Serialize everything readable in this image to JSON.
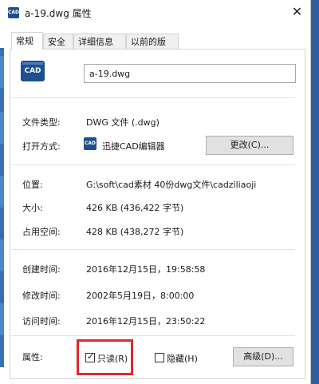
{
  "window": {
    "title": "a-19.dwg 属性",
    "app_icon": "cad-file-icon",
    "close_glyph": "✕"
  },
  "tabs": [
    {
      "label": "常规",
      "active": true
    },
    {
      "label": "安全",
      "active": false
    },
    {
      "label": "详细信息",
      "active": false
    },
    {
      "label": "以前的版本",
      "active": false
    }
  ],
  "file": {
    "icon_text": "CAD",
    "name": "a-19.dwg"
  },
  "type_row": {
    "label": "文件类型:",
    "value": "DWG 文件 (.dwg)"
  },
  "open_with": {
    "label": "打开方式:",
    "icon_text": "CAD",
    "app": "迅捷CAD编辑器",
    "change_button": "更改(C)..."
  },
  "location": {
    "label": "位置:",
    "value": "G:\\soft\\cad素材 40份dwg文件\\cadziliaoji"
  },
  "size": {
    "label": "大小:",
    "value": "426 KB (436,422 字节)"
  },
  "size_on_disk": {
    "label": "占用空间:",
    "value": "428 KB (438,272 字节)"
  },
  "created": {
    "label": "创建时间:",
    "value": "2016年12月15日，19:58:58"
  },
  "modified": {
    "label": "修改时间:",
    "value": "2002年5月19日，8:00:00"
  },
  "accessed": {
    "label": "访问时间:",
    "value": "2016年12月15日，23:50:22"
  },
  "attributes": {
    "label": "属性:",
    "readonly_label": "只读(R)",
    "readonly_checked": true,
    "hidden_label": "隐藏(H)",
    "hidden_checked": false,
    "advanced_button": "高级(D)..."
  },
  "colors": {
    "highlight": "#e0282e",
    "cad_icon": "#1d4f91"
  }
}
